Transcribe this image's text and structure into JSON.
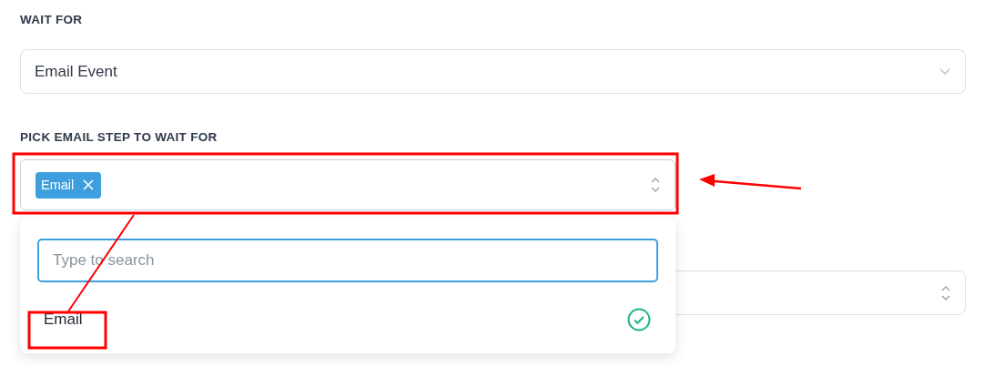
{
  "wait_for": {
    "label": "WAIT FOR",
    "value": "Email Event"
  },
  "pick_email_step": {
    "label": "PICK EMAIL STEP TO WAIT FOR",
    "tags": [
      "Email"
    ],
    "expanded": true,
    "dropdown": {
      "search": {
        "placeholder": "Type to search"
      },
      "options": [
        {
          "label": "Email",
          "selected": true
        }
      ]
    }
  }
}
